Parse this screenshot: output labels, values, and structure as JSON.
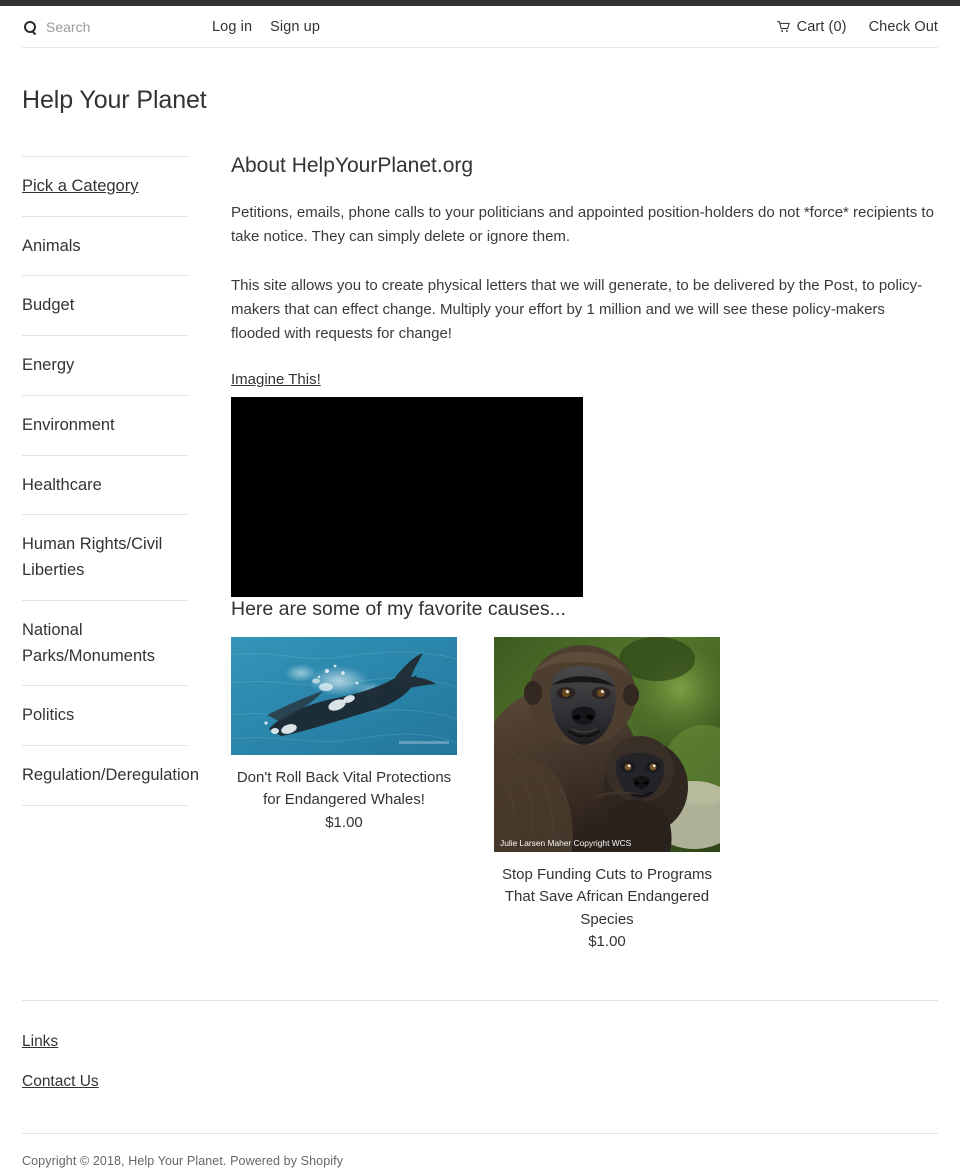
{
  "topbar": {
    "search": {
      "icon": "search-icon",
      "placeholder": "Search",
      "value": ""
    },
    "links": [
      {
        "label": "Log in"
      },
      {
        "label": "Sign up"
      }
    ],
    "cart": {
      "icon": "shopping-cart-icon",
      "label": "Cart (0)",
      "count": 0
    },
    "checkout": {
      "label": "Check Out"
    }
  },
  "header": {
    "site_title": "Help Your Planet"
  },
  "sidebar": {
    "items": [
      {
        "label": "Pick a Category",
        "active": true
      },
      {
        "label": "Animals",
        "active": false
      },
      {
        "label": "Budget",
        "active": false
      },
      {
        "label": "Energy",
        "active": false
      },
      {
        "label": "Environment",
        "active": false
      },
      {
        "label": "Healthcare",
        "active": false
      },
      {
        "label": "Human Rights/Civil Liberties",
        "active": false
      },
      {
        "label": "National Parks/Monuments",
        "active": false
      },
      {
        "label": "Politics",
        "active": false
      },
      {
        "label": "Regulation/Deregulation",
        "active": false
      }
    ]
  },
  "main": {
    "title": "About HelpYourPlanet.org",
    "paragraphs": [
      "Petitions, emails, phone calls to your politicians and appointed position-holders do not *force* recipients to take notice. They can simply delete or ignore them.",
      "This site allows you to create physical letters that we will generate, to be delivered by the Post, to policy-makers that can effect change. Multiply your effort by 1 million and we will see these policy-makers flooded with requests for change!"
    ],
    "imagine_link": "Imagine This! ",
    "video": {
      "name": "embedded-video-player",
      "state": "black"
    },
    "causes_title": "Here are some of my favorite causes...",
    "products": [
      {
        "title": "Don't Roll Back Vital Protections for Endangered Whales!",
        "price": "$1.00",
        "image_alt": "aerial-photo-of-whale-swimming-in-blue-ocean",
        "watermark": ""
      },
      {
        "title": "Stop Funding Cuts to Programs That Save African Endangered Species",
        "price": "$1.00",
        "image_alt": "gorilla-mother-holding-baby-gorilla",
        "watermark": "Julie Larsen Maher Copyright WCS"
      }
    ]
  },
  "footer": {
    "heading": "Links",
    "links": [
      {
        "label": "Contact Us"
      }
    ],
    "copyright": "Copyright © 2018, Help Your Planet. Powered by Shopify"
  },
  "colors": {
    "top_strip": "#323232",
    "text": "#333333",
    "rule": "#e4e4e4",
    "video_bg": "#000000",
    "ocean": "#2e87ab"
  }
}
